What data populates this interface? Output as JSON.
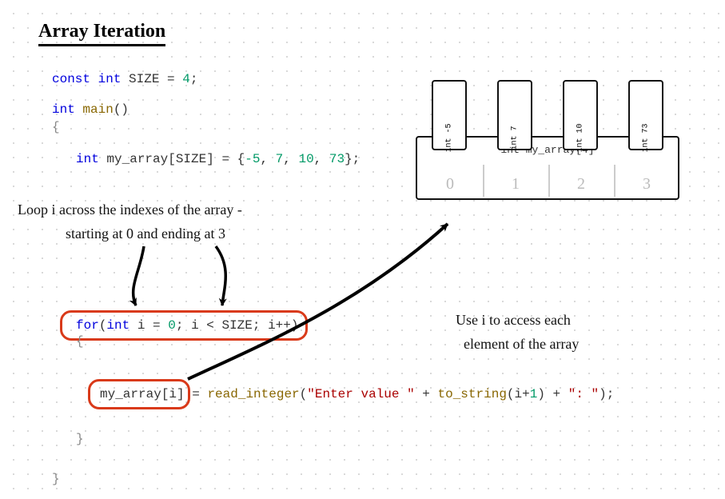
{
  "title": "Array Iteration",
  "code": {
    "line1_const": "const",
    "line1_int": " int",
    "line1_name": " SIZE = ",
    "line1_val": "4",
    "line1_semi": ";",
    "line2_int": "int",
    "line2_main": " main",
    "line2_paren": "()",
    "line3_brace": "{",
    "line4_int": "int",
    "line4_arr": " my_array[SIZE] = {",
    "line4_v1": "-5",
    "line4_c1": ", ",
    "line4_v2": "7",
    "line4_c2": ", ",
    "line4_v3": "10",
    "line4_c3": ", ",
    "line4_v4": "73",
    "line4_end": "};",
    "for_kw": "for",
    "for_open": "(",
    "for_int": "int",
    "for_init": " i = ",
    "for_zero": "0",
    "for_cond": "; i < SIZE; i++)",
    "for_brace": "{",
    "assign_lhs": "my_array[i]",
    "assign_eq": " = ",
    "assign_fn": "read_integer",
    "assign_open": "(",
    "assign_str1": "\"Enter value \"",
    "assign_plus1": " + ",
    "assign_tostr": "to_string",
    "assign_arg": "(i+",
    "assign_one": "1",
    "assign_argend": ") + ",
    "assign_str2": "\": \"",
    "assign_end": ");",
    "close_inner": "}",
    "close_outer": "}"
  },
  "annotations": {
    "loop_note_l1": "Loop i across the indexes of the array -",
    "loop_note_l2": "starting at 0 and ending at 3",
    "use_note_l1": "Use i to access each",
    "use_note_l2": "element of the array"
  },
  "array_box": {
    "label": "int my_array[4]",
    "indices": [
      "0",
      "1",
      "2",
      "3"
    ],
    "cards": [
      {
        "val": "-5",
        "type": "int"
      },
      {
        "val": "7",
        "type": "int"
      },
      {
        "val": "10",
        "type": "int"
      },
      {
        "val": "73",
        "type": "int"
      }
    ]
  }
}
